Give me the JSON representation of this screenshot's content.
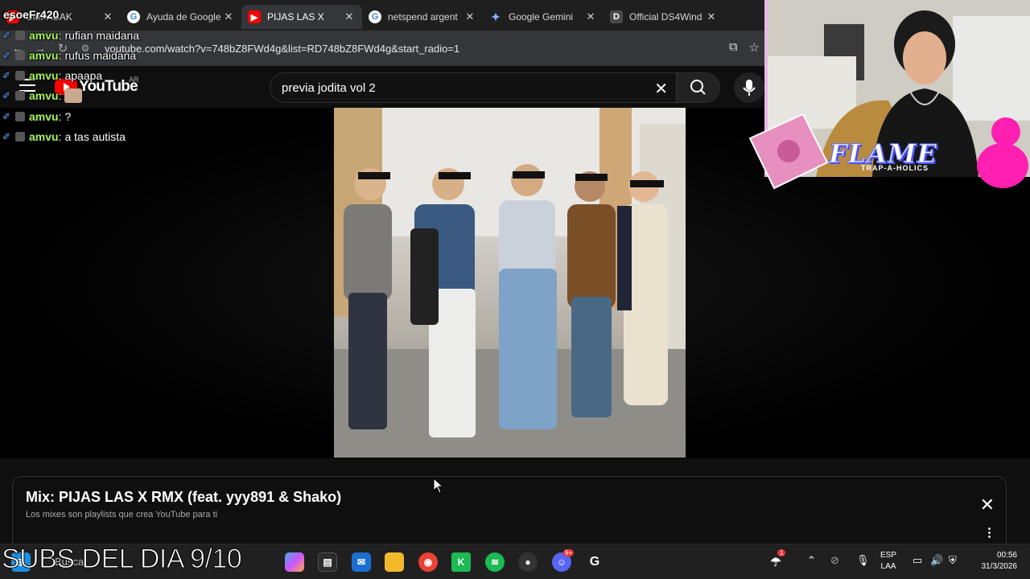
{
  "browser": {
    "tabs": [
      {
        "label": "UMPASAK",
        "icon": "youtube-icon"
      },
      {
        "label": "Ayuda de Google",
        "icon": "google-icon"
      },
      {
        "label": "PIJAS LAS X",
        "icon": "youtube-icon",
        "active": true
      },
      {
        "label": "netspend argent",
        "icon": "google-icon"
      },
      {
        "label": "Google Gemini",
        "icon": "gemini-icon"
      },
      {
        "label": "Official DS4Wind",
        "icon": "ds4-icon"
      }
    ],
    "url": "youtube.com/watch?v=748bZ8FWd4g&list=RD748bZ8FWd4g&start_radio=1"
  },
  "youtube": {
    "logo_text": "YouTube",
    "country": "AR",
    "search_value": "previa jodita vol 2"
  },
  "chat": {
    "streamer": "esoeFr420",
    "messages": [
      {
        "user": "amvu",
        "text": "rufian maidana"
      },
      {
        "user": "amvu",
        "text": "rufus maidana"
      },
      {
        "user": "amvu",
        "text": "apaapa"
      },
      {
        "user": "amvu",
        "text": ""
      },
      {
        "user": "amvu",
        "text": "?"
      },
      {
        "user": "amvu",
        "text": "a tas autista"
      }
    ]
  },
  "playlist": {
    "title": "Mix: PIJAS LAS X RMX (feat. yyy891 & Shako)",
    "subtitle": "Los mixes son playlists que crea YouTube para ti"
  },
  "overlay": {
    "subs_text": "SUBS DEL DIA 9/10",
    "flame_text": "FLAME",
    "flame_sub": "TRAP-A-HOLICS"
  },
  "taskbar": {
    "search_label": "Buscar",
    "lang_1": "ESP",
    "lang_2": "LAA",
    "time": "00:56",
    "date": "31/3/2026",
    "weather_badge": "1",
    "discord_badge": "9+"
  },
  "colors": {
    "youtube_red": "#ff0000",
    "chat_user": "#a6f35a",
    "accent_pink": "#e8b7e8"
  }
}
